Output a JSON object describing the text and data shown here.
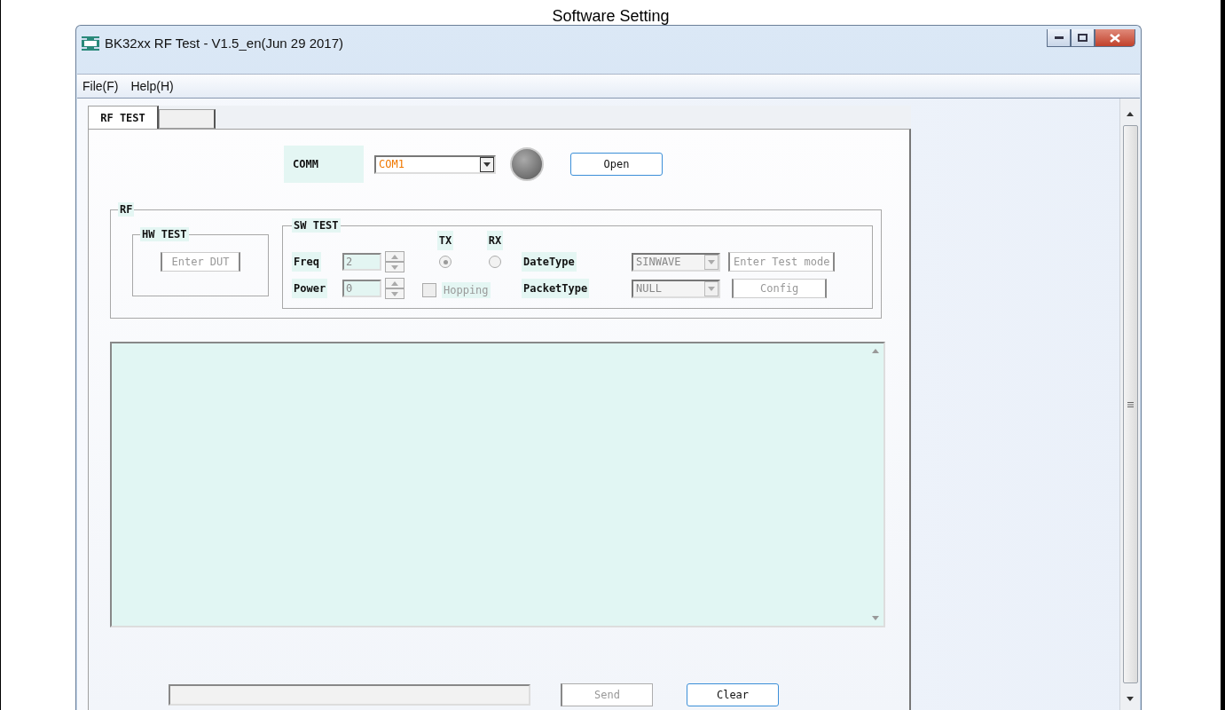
{
  "caption": "Software Setting",
  "window": {
    "title": "BK32xx RF Test - V1.5_en(Jun 29 2017)"
  },
  "menu": [
    "File(F)",
    "Help(H)"
  ],
  "tabs": [
    {
      "label": "RF TEST",
      "selected": true
    },
    {
      "selected": false
    }
  ],
  "comm": {
    "label": "COMM",
    "port": "COM1",
    "connected": false,
    "button": "Open"
  },
  "rf": {
    "title": "RF",
    "hw_test": {
      "title": "HW TEST",
      "button": "Enter DUT",
      "disabled": true
    },
    "sw_test": {
      "title": "SW TEST",
      "disabled": true,
      "freq": {
        "label": "Freq",
        "value": "2"
      },
      "power": {
        "label": "Power",
        "value": "0"
      },
      "modes": [
        {
          "label": "TX",
          "selected": true
        },
        {
          "label": "RX",
          "selected": false
        }
      ],
      "hopping": {
        "label": "Hopping",
        "checked": false
      },
      "date_type": {
        "label": "DateType",
        "value": "SINWAVE"
      },
      "packet_type": {
        "label": "PacketType",
        "value": "NULL"
      },
      "buttons": [
        "Enter Test mode",
        "Config"
      ]
    }
  },
  "send_bar": {
    "buttons": [
      {
        "label": "Send",
        "disabled": true
      },
      {
        "label": "Clear",
        "disabled": false
      }
    ]
  }
}
